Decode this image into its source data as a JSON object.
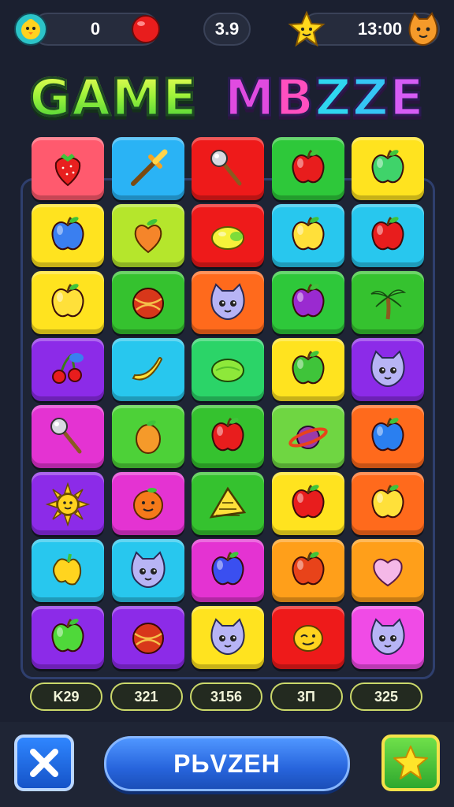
{
  "hud": {
    "score": "0",
    "multiplier": "3.9",
    "time": "13:00",
    "icons": [
      "chick-icon",
      "red-ball-icon",
      "star-face-icon",
      "cat-face-icon"
    ]
  },
  "title": {
    "word1": "GAME",
    "word2": "MBZZE",
    "word1_color": "#8fef3a",
    "word2_colors": [
      "#e04be0",
      "#ff4fc0",
      "#2fd6f0",
      "#35c5f5",
      "#d65cf5"
    ]
  },
  "board": {
    "rows": 8,
    "cols": 5,
    "tiles": [
      [
        {
          "color": "#ff5a6e",
          "icon": "strawberry-icon"
        },
        {
          "color": "#2ab3f5",
          "icon": "sword-icon"
        },
        {
          "color": "#ee1a1a",
          "icon": "hammer-icon"
        },
        {
          "color": "#2ec83a",
          "icon": "apple-icon"
        },
        {
          "color": "#ffe31f",
          "icon": "apple-icon"
        }
      ],
      [
        {
          "color": "#ffe31f",
          "icon": "apple-icon"
        },
        {
          "color": "#b5e62c",
          "icon": "heart-fruit-icon"
        },
        {
          "color": "#ee1a1a",
          "icon": "lemon-icon"
        },
        {
          "color": "#28c7ee",
          "icon": "apple-icon"
        },
        {
          "color": "#28c7ee",
          "icon": "apple-icon"
        }
      ],
      [
        {
          "color": "#ffe31f",
          "icon": "apple-icon"
        },
        {
          "color": "#35c22f",
          "icon": "ball-icon"
        },
        {
          "color": "#ff6a1c",
          "icon": "cat-face-icon"
        },
        {
          "color": "#2ec83a",
          "icon": "apple-icon"
        },
        {
          "color": "#35c22f",
          "icon": "palm-tree-icon"
        }
      ],
      [
        {
          "color": "#8c2be8",
          "icon": "cherry-icon"
        },
        {
          "color": "#28c7ee",
          "icon": "banana-icon"
        },
        {
          "color": "#2bd468",
          "icon": "lime-icon"
        },
        {
          "color": "#ffe31f",
          "icon": "apple-icon"
        },
        {
          "color": "#8c2be8",
          "icon": "cat-face-icon"
        }
      ],
      [
        {
          "color": "#e433d2",
          "icon": "hammer-icon"
        },
        {
          "color": "#4dd138",
          "icon": "orange-icon"
        },
        {
          "color": "#35c22f",
          "icon": "apple-icon"
        },
        {
          "color": "#6fd642",
          "icon": "planet-icon"
        },
        {
          "color": "#ff6a1c",
          "icon": "apple-icon"
        }
      ],
      [
        {
          "color": "#8c2be8",
          "icon": "sun-icon"
        },
        {
          "color": "#e433d2",
          "icon": "orange-face-icon"
        },
        {
          "color": "#35c22f",
          "icon": "racket-icon"
        },
        {
          "color": "#ffe31f",
          "icon": "apple-icon"
        },
        {
          "color": "#ff6a1c",
          "icon": "apple-icon"
        }
      ],
      [
        {
          "color": "#28c7ee",
          "icon": "pepper-icon"
        },
        {
          "color": "#28c7ee",
          "icon": "cat-face-icon"
        },
        {
          "color": "#e433d2",
          "icon": "apple-icon"
        },
        {
          "color": "#ff9f1a",
          "icon": "apple-icon"
        },
        {
          "color": "#ff9f1a",
          "icon": "heart-icon"
        }
      ],
      [
        {
          "color": "#8c2be8",
          "icon": "apple-icon"
        },
        {
          "color": "#8c2be8",
          "icon": "ball-icon"
        },
        {
          "color": "#ffe31f",
          "icon": "cat-face-icon"
        },
        {
          "color": "#ee1a1a",
          "icon": "lemon-face-icon"
        },
        {
          "color": "#f04be6",
          "icon": "cat-face-icon"
        }
      ]
    ]
  },
  "scores": [
    "K29",
    "321",
    "3156",
    "3П",
    "325"
  ],
  "footer": {
    "close_icon": "close-icon",
    "main_button_label": "PЬVZEH",
    "star_icon": "star-icon"
  }
}
